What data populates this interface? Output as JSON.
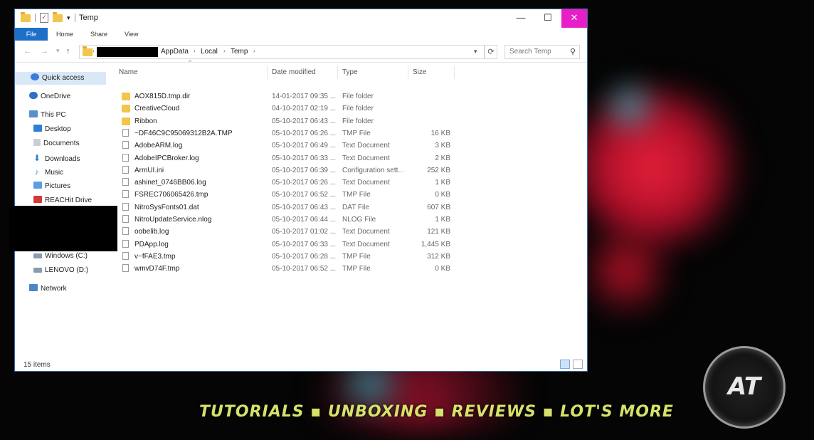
{
  "window": {
    "title": "Temp"
  },
  "ribbon": {
    "tabs": [
      "File",
      "Home",
      "Share",
      "View"
    ]
  },
  "address": {
    "crumbs": [
      "AppData",
      "Local",
      "Temp"
    ],
    "search_placeholder": "Search Temp"
  },
  "nav_pane": {
    "items": [
      "Quick access",
      "OneDrive",
      "This PC",
      "Desktop",
      "Documents",
      "Downloads",
      "Music",
      "Pictures",
      "REACHit Drive",
      "Windows (C:)",
      "LENOVO (D:)",
      "Network"
    ]
  },
  "columns": {
    "name": "Name",
    "date": "Date modified",
    "type": "Type",
    "size": "Size"
  },
  "files": [
    {
      "name": "AOX815D.tmp.dir",
      "date": "14-01-2017 09:35 ...",
      "type": "File folder",
      "size": "",
      "kind": "folder"
    },
    {
      "name": "CreativeCloud",
      "date": "04-10-2017 02:19 ...",
      "type": "File folder",
      "size": "",
      "kind": "folder"
    },
    {
      "name": "Ribbon",
      "date": "05-10-2017 06:43 ...",
      "type": "File folder",
      "size": "",
      "kind": "folder"
    },
    {
      "name": "~DF46C9C95069312B2A.TMP",
      "date": "05-10-2017 06:26 ...",
      "type": "TMP File",
      "size": "16 KB",
      "kind": "file"
    },
    {
      "name": "AdobeARM.log",
      "date": "05-10-2017 06:49 ...",
      "type": "Text Document",
      "size": "3 KB",
      "kind": "file"
    },
    {
      "name": "AdobeIPCBroker.log",
      "date": "05-10-2017 06:33 ...",
      "type": "Text Document",
      "size": "2 KB",
      "kind": "file"
    },
    {
      "name": "ArmUI.ini",
      "date": "05-10-2017 06:39 ...",
      "type": "Configuration sett...",
      "size": "252 KB",
      "kind": "file"
    },
    {
      "name": "ashinet_0746BB06.log",
      "date": "05-10-2017 06:26 ...",
      "type": "Text Document",
      "size": "1 KB",
      "kind": "file"
    },
    {
      "name": "FSREC706065426.tmp",
      "date": "05-10-2017 06:52 ...",
      "type": "TMP File",
      "size": "0 KB",
      "kind": "file"
    },
    {
      "name": "NitroSysFonts01.dat",
      "date": "05-10-2017 06:43 ...",
      "type": "DAT File",
      "size": "607 KB",
      "kind": "file"
    },
    {
      "name": "NitroUpdateService.nlog",
      "date": "05-10-2017 06:44 ...",
      "type": "NLOG File",
      "size": "1 KB",
      "kind": "file"
    },
    {
      "name": "oobelib.log",
      "date": "05-10-2017 01:02 ...",
      "type": "Text Document",
      "size": "121 KB",
      "kind": "file"
    },
    {
      "name": "PDApp.log",
      "date": "05-10-2017 06:33 ...",
      "type": "Text Document",
      "size": "1,445 KB",
      "kind": "file"
    },
    {
      "name": "v~fFAE3.tmp",
      "date": "05-10-2017 06:28 ...",
      "type": "TMP File",
      "size": "312 KB",
      "kind": "file"
    },
    {
      "name": "wmvD74F.tmp",
      "date": "05-10-2017 06:52 ...",
      "type": "TMP File",
      "size": "0 KB",
      "kind": "file"
    }
  ],
  "status": {
    "count": "15 items"
  },
  "overlay": {
    "tagline": "TUTORIALS ▪ UNBOXING ▪ REVIEWS ▪ LOT'S MORE",
    "logo": "AT"
  },
  "colors": {
    "accent": "#1e6fc8",
    "close": "#e81ec8"
  }
}
